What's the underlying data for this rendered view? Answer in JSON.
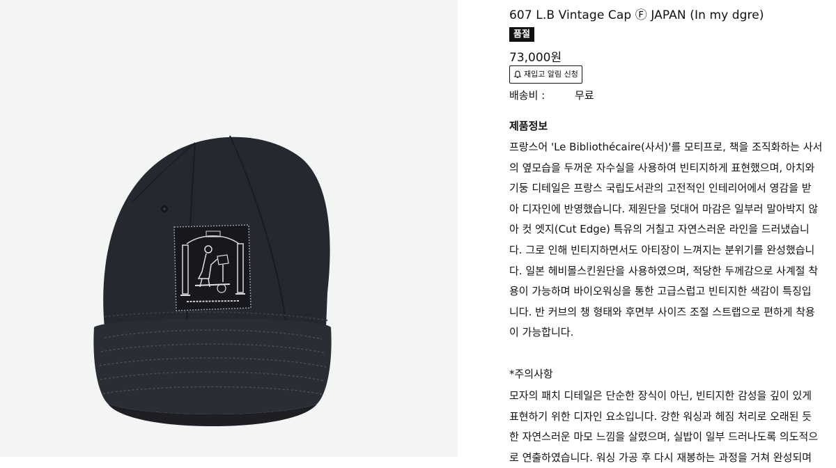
{
  "product": {
    "title": "607 L.B Vintage Cap Ⓕ JAPAN (In my dgre)",
    "soldout_badge": "품절",
    "price": "73,000원",
    "restock_button": "재입고 알림 신청",
    "shipping_label": "배송비 :",
    "shipping_value": "무료",
    "image_alt": "Navy vintage baseball cap with embroidered patch"
  },
  "info": {
    "section_title": "제품정보",
    "description_lines": [
      "프랑스어 'Le Bibliothécaire(사서)'를 모티프로, 책을 조직화하는 사서",
      "의 옆모습을 두꺼운 자수실을 사용하여 빈티지하게 표현했으며, 아치와",
      "기둥 디테일은 프랑스 국립도서관의 고전적인 인테리어에서 영감을 받",
      "아 디자인에 반영했습니다. 제원단을 덧대어 마감은 일부러 말아박지 않",
      "아 컷 엣지(Cut Edge) 특유의 거칠고 자연스러운 라인을 드러냈습니",
      "다. 그로 인해 빈티지하면서도 아티장이 느껴지는 분위기를 완성했습니",
      "다. 일본 헤비몰스킨원단을 사용하였으며, 적당한 두께감으로 사계절 착",
      "용이 가능하며 바이오워싱을 통한 고급스럽고 빈티지한 색감이 특징입",
      "니다. 반 커브의 챙 형태와 후면부 사이즈 조절 스트랩으로 편하게 착용",
      "이 가능합니다."
    ],
    "notice_title": "*주의사항",
    "notice_lines": [
      "모자의 패치 디테일은 단순한 장식이 아닌, 빈티지한 감성을 깊이 있게",
      "표현하기 위한 디자인 요소입니다. 강한 워싱과 헤짐 처리로 오래된 듯",
      "한 자연스러운 마모 느낌을 살렸으며, 실밥이 일부 드러나도록 의도적으",
      "로 연출하였습니다. 워싱 가공 후 다시 재봉하는 과정을 거쳐 완성되며"
    ]
  },
  "colors": {
    "cap": "#26282f",
    "background": "#f3f4f4",
    "badge": "#111111"
  },
  "icons": {
    "restock": "bell-icon"
  }
}
